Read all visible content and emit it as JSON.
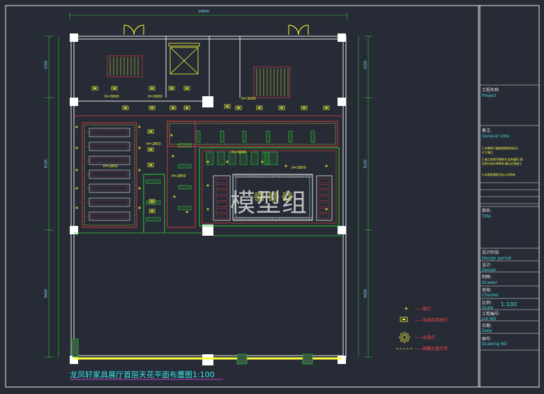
{
  "drawing": {
    "title": "龙凤轩家具展厅首层天花平面布置图1:100",
    "watermark": "模型组",
    "dims": {
      "top_total": "24600",
      "left_a": "4200",
      "left_b": "8100",
      "left_c": "9600",
      "right_a": "4200",
      "right_b": "8100",
      "right_c": "9600"
    },
    "elev_tags": [
      "H=3000",
      "H=3000",
      "H=3000",
      "H=2850",
      "H=2850",
      "H=3000",
      "H=2850",
      "H=2850"
    ]
  },
  "legend": {
    "items": [
      {
        "symbol": "plus",
        "label": "筒灯"
      },
      {
        "symbol": "box-light",
        "label": "金卤石英射灯"
      },
      {
        "symbol": "chandelier",
        "label": "水晶灯"
      },
      {
        "symbol": "dash-line",
        "label": "暗藏光管灯带"
      }
    ]
  },
  "title_block": {
    "project_cn": "工程名称",
    "project_en": "Project",
    "note_cn": "备注:",
    "note_en": "General note",
    "note_lines": [
      "1.本图纸只能按照图纸所标注",
      "  尺寸施工.",
      "2.施工前须仔细核对,若有疑问,请",
      "  及时与设计师联系,确认后再施工",
      "3.本图纸版权归本公司所有"
    ],
    "title_cn": "图名:",
    "title_en": "Title",
    "period_cn": "设计阶段:",
    "period_en": "Design period",
    "design_cn": "设计:",
    "design_en": "Design",
    "drawer_cn": "制图:",
    "drawer_en": "Drawer",
    "checker_cn": "审核:",
    "checker_en": "Checker",
    "scale_cn": "比例:",
    "scale_en": "Scale",
    "scale_value": "1:100",
    "job_cn": "工程编号:",
    "job_en": "Job NO",
    "date_cn": "日期:",
    "date_en": "Date",
    "drawing_cn": "图号:",
    "drawing_en": "Drawing NO"
  },
  "colors": {
    "background": "#262b36",
    "frame": "#e8e8e8",
    "walls": "#e8e8e8",
    "lights": "#ffff3a",
    "ceiling": "#ff4040",
    "partitions": "#2fd12f",
    "dimension": "#7fd6ff"
  }
}
